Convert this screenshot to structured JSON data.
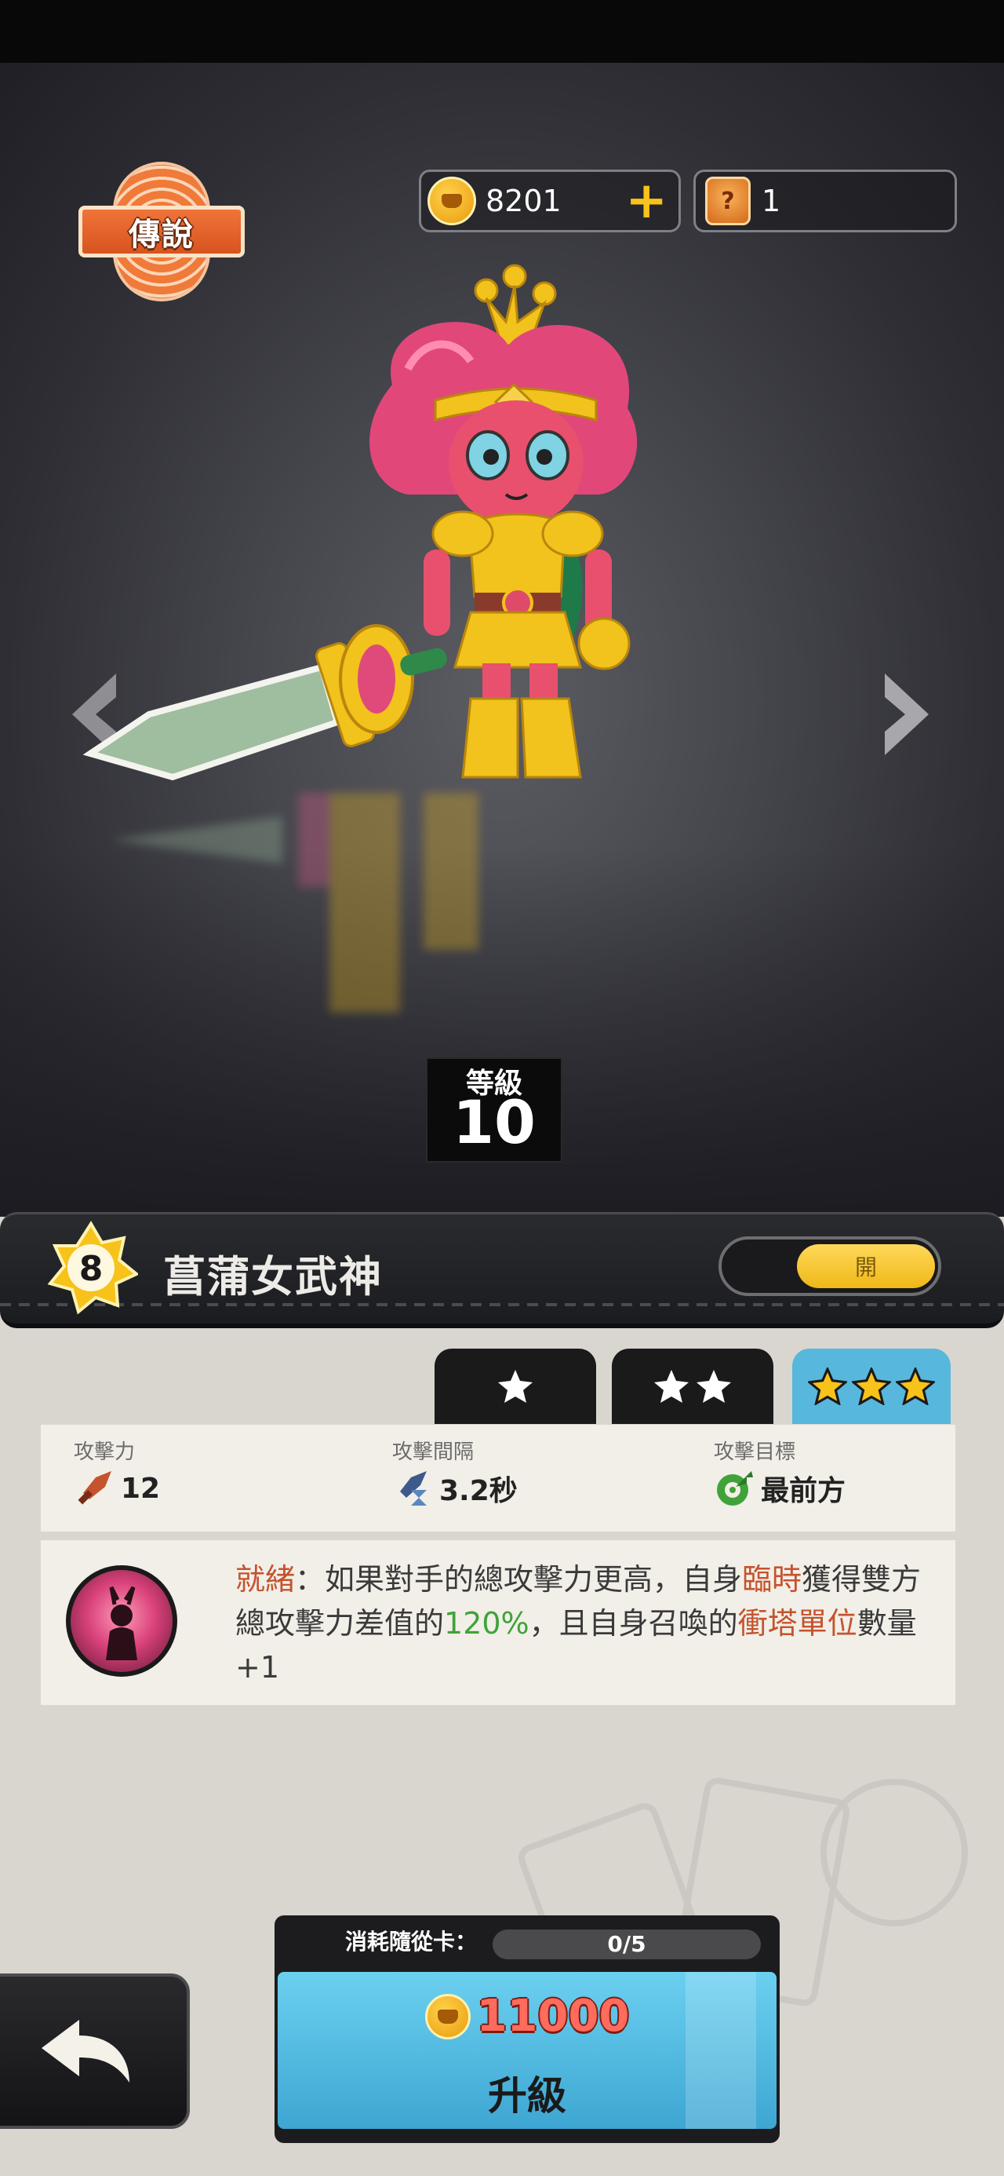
{
  "rarity": "傳說",
  "currency": {
    "gold": "8201",
    "summon_tickets": "1"
  },
  "hero": {
    "level_label": "等級",
    "level": "10",
    "star_rank": "8",
    "name": "菖蒲女武神",
    "toggle_label": "開"
  },
  "tabs": [
    {
      "stars": 1,
      "selected": false
    },
    {
      "stars": 2,
      "selected": false
    },
    {
      "stars": 3,
      "selected": true
    }
  ],
  "stats": {
    "attack": {
      "label": "攻擊力",
      "value": "12"
    },
    "interval": {
      "label": "攻擊間隔",
      "value": "3.2秒"
    },
    "target": {
      "label": "攻擊目標",
      "value": "最前方"
    }
  },
  "skill": {
    "name": "就緒",
    "t1": "：如果對手的總攻擊力更高，自身",
    "h1": "臨時",
    "t2": "獲得雙方總攻擊力差值的",
    "h2": "120%",
    "t3": "，且自身召喚的",
    "h3": "衝塔單位",
    "t4": "數量+1"
  },
  "upgrade": {
    "cost_label": "消耗隨從卡：",
    "card_progress": "0/5",
    "gold_cost": "11000",
    "button_label": "升級"
  },
  "colors": {
    "accent_blue": "#58b7dc",
    "gold": "#f7c21a",
    "highlight_red": "#c5532e",
    "highlight_green": "#3fa33a"
  }
}
